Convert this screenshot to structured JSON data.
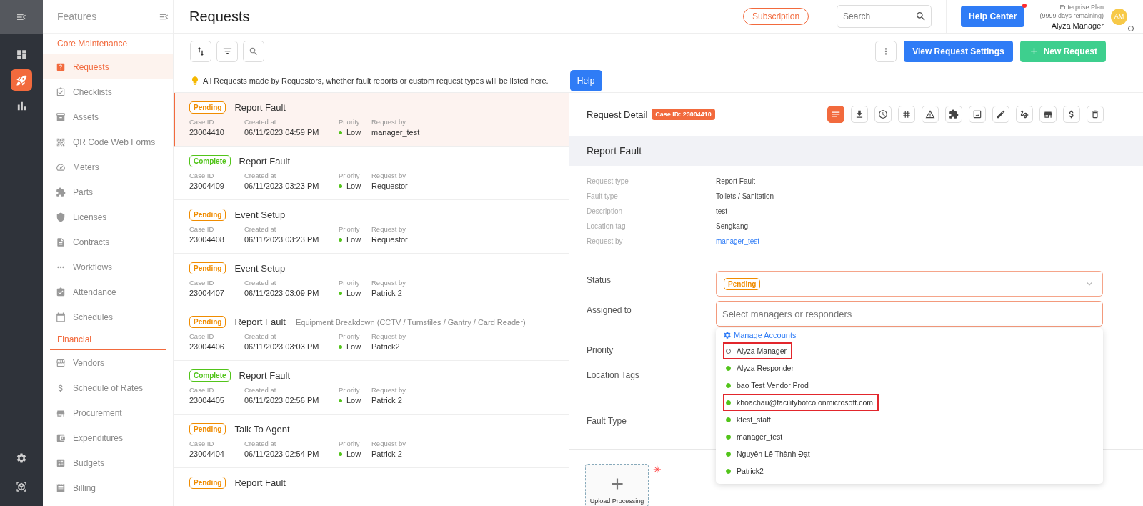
{
  "rail": {
    "top": {
      "kind": "collapse"
    },
    "items": [
      {
        "kind": "dashboard",
        "selected": false
      },
      {
        "kind": "rocket",
        "selected": true
      },
      {
        "kind": "chart",
        "selected": false
      }
    ],
    "bottom": [
      {
        "kind": "settings",
        "selected": false
      },
      {
        "kind": "box",
        "selected": false
      }
    ]
  },
  "sidebar": {
    "title": "Features",
    "sections": [
      {
        "heading": "Core Maintenance",
        "items": [
          {
            "label": "Requests",
            "kind": "requests",
            "selected": true
          },
          {
            "label": "Checklists",
            "kind": "checklists",
            "selected": false
          },
          {
            "label": "Assets",
            "kind": "assets",
            "selected": false
          },
          {
            "label": "QR Code Web Forms",
            "kind": "qr",
            "selected": false
          },
          {
            "label": "Meters",
            "kind": "meters",
            "selected": false
          },
          {
            "label": "Parts",
            "kind": "parts",
            "selected": false
          },
          {
            "label": "Licenses",
            "kind": "licenses",
            "selected": false
          },
          {
            "label": "Contracts",
            "kind": "contracts",
            "selected": false
          },
          {
            "label": "Workflows",
            "kind": "workflows",
            "selected": false
          },
          {
            "label": "Attendance",
            "kind": "attendance",
            "selected": false
          },
          {
            "label": "Schedules",
            "kind": "schedules",
            "selected": false
          }
        ]
      },
      {
        "heading": "Financial",
        "items": [
          {
            "label": "Vendors",
            "kind": "vendors",
            "selected": false
          },
          {
            "label": "Schedule of Rates",
            "kind": "rates",
            "selected": false
          },
          {
            "label": "Procurement",
            "kind": "procurement",
            "selected": false
          },
          {
            "label": "Expenditures",
            "kind": "expenditures",
            "selected": false
          },
          {
            "label": "Budgets",
            "kind": "budgets",
            "selected": false
          },
          {
            "label": "Billing",
            "kind": "billing",
            "selected": false
          }
        ]
      }
    ]
  },
  "header": {
    "title": "Requests",
    "subscription": "Subscription",
    "search_placeholder": "Search",
    "help_center": "Help Center",
    "help_center_notification": true,
    "plan": "Enterprise Plan",
    "plan_remaining": "(9999 days remaining)",
    "user_name": "Alyza Manager",
    "avatar_initials": "AM",
    "user_online": false
  },
  "toolbar": {
    "view_settings": "View Request Settings",
    "new_request": "New Request"
  },
  "info": {
    "text": "All Requests made by Requestors, whether fault reports or custom request types will be listed here.",
    "help": "Help"
  },
  "requests": [
    {
      "status": {
        "label": "Pending",
        "color": "#f08c00"
      },
      "title": "Report Fault",
      "selected": true,
      "fields": [
        {
          "label": "Case ID",
          "value": "23004410",
          "kind": "text"
        },
        {
          "label": "Created at",
          "value": "06/11/2023 04:59 PM",
          "kind": "text"
        },
        {
          "label": "Priority",
          "value": "Low",
          "kind": "priority"
        },
        {
          "label": "Request by",
          "value": "manager_test",
          "kind": "text"
        }
      ]
    },
    {
      "status": {
        "label": "Complete",
        "color": "#52c41a"
      },
      "title": "Report Fault",
      "selected": false,
      "fields": [
        {
          "label": "Case ID",
          "value": "23004409",
          "kind": "text"
        },
        {
          "label": "Created at",
          "value": "06/11/2023 03:23 PM",
          "kind": "text"
        },
        {
          "label": "Priority",
          "value": "Low",
          "kind": "priority"
        },
        {
          "label": "Request by",
          "value": "Requestor",
          "kind": "text"
        }
      ]
    },
    {
      "status": {
        "label": "Pending",
        "color": "#f08c00"
      },
      "title": "Event Setup",
      "selected": false,
      "fields": [
        {
          "label": "Case ID",
          "value": "23004408",
          "kind": "text"
        },
        {
          "label": "Created at",
          "value": "06/11/2023 03:23 PM",
          "kind": "text"
        },
        {
          "label": "Priority",
          "value": "Low",
          "kind": "priority"
        },
        {
          "label": "Request by",
          "value": "Requestor",
          "kind": "text"
        }
      ]
    },
    {
      "status": {
        "label": "Pending",
        "color": "#f08c00"
      },
      "title": "Event Setup",
      "selected": false,
      "fields": [
        {
          "label": "Case ID",
          "value": "23004407",
          "kind": "text"
        },
        {
          "label": "Created at",
          "value": "06/11/2023 03:09 PM",
          "kind": "text"
        },
        {
          "label": "Priority",
          "value": "Low",
          "kind": "priority"
        },
        {
          "label": "Request by",
          "value": "Patrick 2",
          "kind": "text"
        }
      ]
    },
    {
      "status": {
        "label": "Pending",
        "color": "#f08c00"
      },
      "title": "Report Fault",
      "subtitle": "Equipment Breakdown (CCTV / Turnstiles / Gantry / Card Reader)",
      "selected": false,
      "fields": [
        {
          "label": "Case ID",
          "value": "23004406",
          "kind": "text"
        },
        {
          "label": "Created at",
          "value": "06/11/2023 03:03 PM",
          "kind": "text"
        },
        {
          "label": "Priority",
          "value": "Low",
          "kind": "priority"
        },
        {
          "label": "Request by",
          "value": "Patrick2",
          "kind": "text"
        }
      ]
    },
    {
      "status": {
        "label": "Complete",
        "color": "#52c41a"
      },
      "title": "Report Fault",
      "selected": false,
      "fields": [
        {
          "label": "Case ID",
          "value": "23004405",
          "kind": "text"
        },
        {
          "label": "Created at",
          "value": "06/11/2023 02:56 PM",
          "kind": "text"
        },
        {
          "label": "Priority",
          "value": "Low",
          "kind": "priority"
        },
        {
          "label": "Request by",
          "value": "Patrick 2",
          "kind": "text"
        }
      ]
    },
    {
      "status": {
        "label": "Pending",
        "color": "#f08c00"
      },
      "title": "Talk To Agent",
      "selected": false,
      "fields": [
        {
          "label": "Case ID",
          "value": "23004404",
          "kind": "text"
        },
        {
          "label": "Created at",
          "value": "06/11/2023 02:54 PM",
          "kind": "text"
        },
        {
          "label": "Priority",
          "value": "Low",
          "kind": "priority"
        },
        {
          "label": "Request by",
          "value": "Patrick 2",
          "kind": "text"
        }
      ]
    },
    {
      "status": {
        "label": "Pending",
        "color": "#f08c00"
      },
      "title": "Report Fault",
      "selected": false
    }
  ],
  "detail": {
    "title": "Request Detail",
    "case_badge": "Case ID: 23004410",
    "actions": [
      {
        "kind": "details",
        "selected": true
      },
      {
        "kind": "download",
        "selected": false
      },
      {
        "kind": "clock",
        "selected": false
      },
      {
        "kind": "hash",
        "selected": false
      },
      {
        "kind": "warning",
        "selected": false
      },
      {
        "kind": "puzzle",
        "selected": false
      },
      {
        "kind": "frame",
        "selected": false
      },
      {
        "kind": "edit",
        "selected": false
      },
      {
        "kind": "signature",
        "selected": false
      },
      {
        "kind": "store",
        "selected": false
      },
      {
        "kind": "dollar",
        "selected": false
      },
      {
        "kind": "delete",
        "selected": false
      }
    ],
    "heading": "Report Fault",
    "info": [
      {
        "label": "Request type",
        "value": "Report Fault",
        "kind": "text"
      },
      {
        "label": "Fault type",
        "value": "Toilets / Sanitation",
        "kind": "text"
      },
      {
        "label": "Description",
        "value": "test",
        "kind": "text"
      },
      {
        "label": "Location tag",
        "value": "Sengkang",
        "kind": "text"
      },
      {
        "label": "Request by",
        "value": "manager_test",
        "kind": "link"
      }
    ],
    "form_labels": [
      "Status",
      "Assigned to",
      "Priority",
      "Location Tags",
      "Fault Type"
    ],
    "status": {
      "label": "Pending",
      "color": "#f08c00"
    },
    "assigned_placeholder": "Select managers or responders",
    "dropdown": {
      "manage": "Manage Accounts",
      "options": [
        {
          "name": "Alyza Manager",
          "online": false,
          "highlighted": true
        },
        {
          "name": "Alyza Responder",
          "online": true,
          "highlighted": false
        },
        {
          "name": "bao Test Vendor Prod",
          "online": true,
          "highlighted": false
        },
        {
          "name": "khoachau@facilitybotco.onmicrosoft.com",
          "online": true,
          "highlighted": true
        },
        {
          "name": "ktest_staff",
          "online": true,
          "highlighted": false
        },
        {
          "name": "manager_test",
          "online": true,
          "highlighted": false
        },
        {
          "name": "Nguyễn Lê Thành Đạt",
          "online": true,
          "highlighted": false
        },
        {
          "name": "Patrick2",
          "online": true,
          "highlighted": false
        }
      ]
    },
    "upload": {
      "label": "Upload Processing",
      "required_mark": "✳"
    }
  }
}
